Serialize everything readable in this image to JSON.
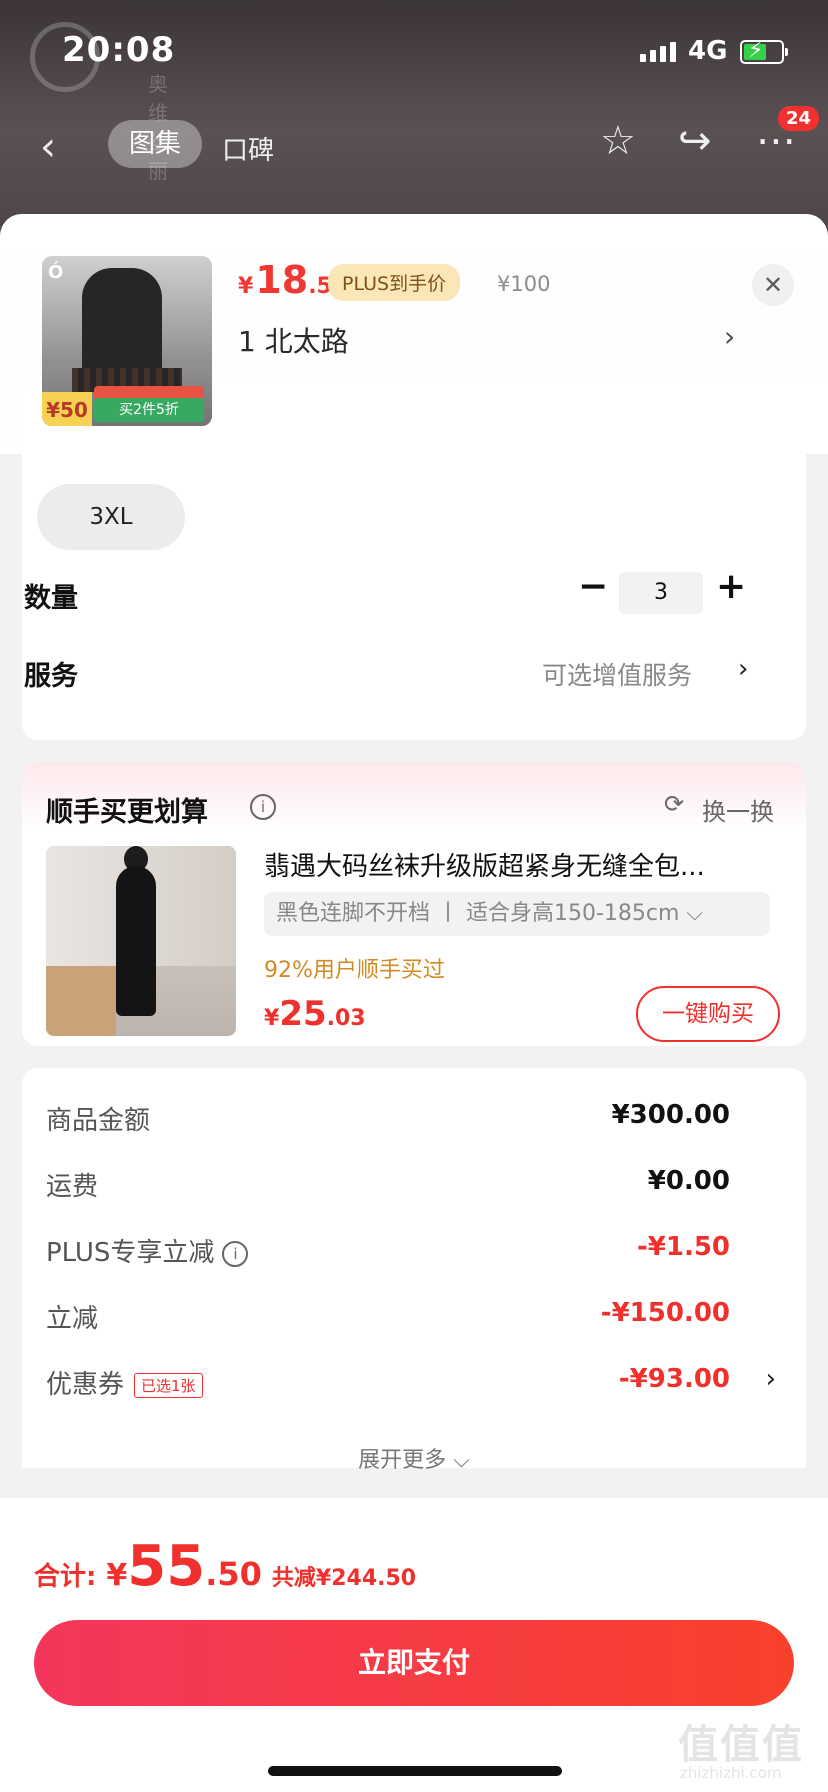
{
  "status": {
    "time": "20:08",
    "network": "4G"
  },
  "background": {
    "brand_text": "奥维丝丽"
  },
  "nav": {
    "back_icon": "‹",
    "tabs": [
      "图集",
      "口碑"
    ],
    "cart_badge": "24"
  },
  "product": {
    "thumb_brand": "Ó",
    "thumb_price_tag": "¥50",
    "thumb_promo": "买2件5折",
    "price_symbol": "¥",
    "price_int": "18",
    "price_dec": ".5",
    "plus_tag": "PLUS到手价",
    "original_price": "¥100",
    "selected_spec": "1  北太路",
    "close_icon": "✕"
  },
  "options": {
    "size_chip": "3XL",
    "quantity_label": "数量",
    "quantity_value": "3",
    "minus_label": "−",
    "plus_label": "+",
    "service_label": "服务",
    "service_value": "可选增值服务"
  },
  "recommend": {
    "title": "顺手买更划算",
    "refresh_label": "换一换",
    "item_name": "翡遇大码丝袜升级版超紧身无缝全包...",
    "item_spec": "黑色连脚不开档 丨 适合身高150-185cm ⌵",
    "item_sold": "92%用户顺手买过",
    "price_symbol": "¥",
    "price_int": "25",
    "price_dec": ".03",
    "button_label": "一键购买"
  },
  "summary": {
    "rows": [
      {
        "label": "商品金额",
        "value": "¥300.00"
      },
      {
        "label": "运费",
        "value": "¥0.00"
      },
      {
        "label": "PLUS专享立减",
        "value": "-¥1.50"
      },
      {
        "label": "立减",
        "value": "-¥150.00"
      },
      {
        "label": "优惠券",
        "value": "-¥93.00",
        "tag": "已选1张"
      }
    ],
    "expand_label": "展开更多 ⌵"
  },
  "footer": {
    "total_label": "合计:",
    "total_symbol": "¥",
    "total_int": "55",
    "total_dec": ".50",
    "saved": "共减¥244.50",
    "pay_button": "立即支付",
    "watermark": "值值值",
    "watermark_sub": "zhizhizhi.com"
  },
  "colors": {
    "accent": "#f0302c",
    "plus_tag_bg": "#fbe6b4",
    "sold_text": "#d48a22"
  }
}
